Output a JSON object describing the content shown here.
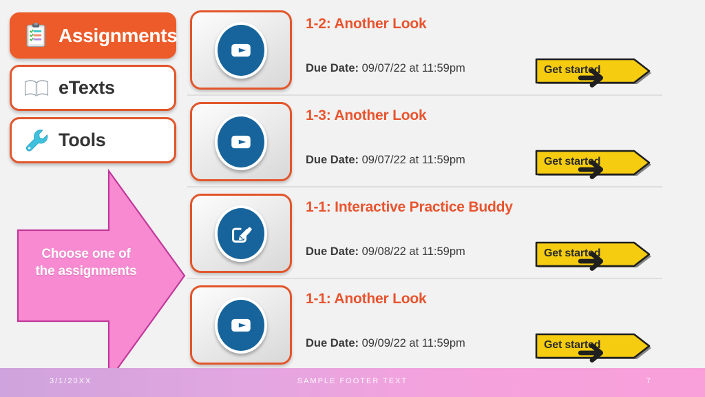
{
  "sidebar": {
    "items": [
      {
        "label": "Assignments",
        "icon": "clipboard-icon",
        "active": true
      },
      {
        "label": "eTexts",
        "icon": "book-icon",
        "active": false
      },
      {
        "label": "Tools",
        "icon": "wrench-icon",
        "active": false
      }
    ]
  },
  "callout": {
    "text": "Choose one of the assignments",
    "fill": "#f78ad1",
    "stroke": "#c0399a"
  },
  "assignments": {
    "due_label": "Due Date:",
    "cta_label": "Get started",
    "rows": [
      {
        "title": "1-2: Another Look",
        "due_label": "Due Date:",
        "due_value": "09/07/22 at 11:59pm",
        "cta_label": "Get started",
        "icon": "video-play-icon"
      },
      {
        "title": "1-3: Another Look",
        "due_label": "Due Date:",
        "due_value": "09/07/22 at 11:59pm",
        "cta_label": "Get started",
        "icon": "video-play-icon"
      },
      {
        "title": "1-1: Interactive Practice Buddy",
        "due_label": "Due Date:",
        "due_value": "09/08/22 at 11:59pm",
        "cta_label": "Get started",
        "icon": "pencil-edit-icon"
      },
      {
        "title": "1-1: Another Look",
        "due_label": "Due Date:",
        "due_value": "09/09/22 at 11:59pm",
        "cta_label": "Get started",
        "icon": "video-play-icon"
      }
    ]
  },
  "footer": {
    "date": "3/1/20XX",
    "text": "SAMPLE FOOTER TEXT",
    "page": "7"
  },
  "colors": {
    "accent_orange": "#ec5b29",
    "title_orange": "#e8542e",
    "icon_blue": "#16649b",
    "cta_yellow": "#f5cc10",
    "callout_pink": "#f78ad1",
    "background": "#f2f2f2"
  }
}
